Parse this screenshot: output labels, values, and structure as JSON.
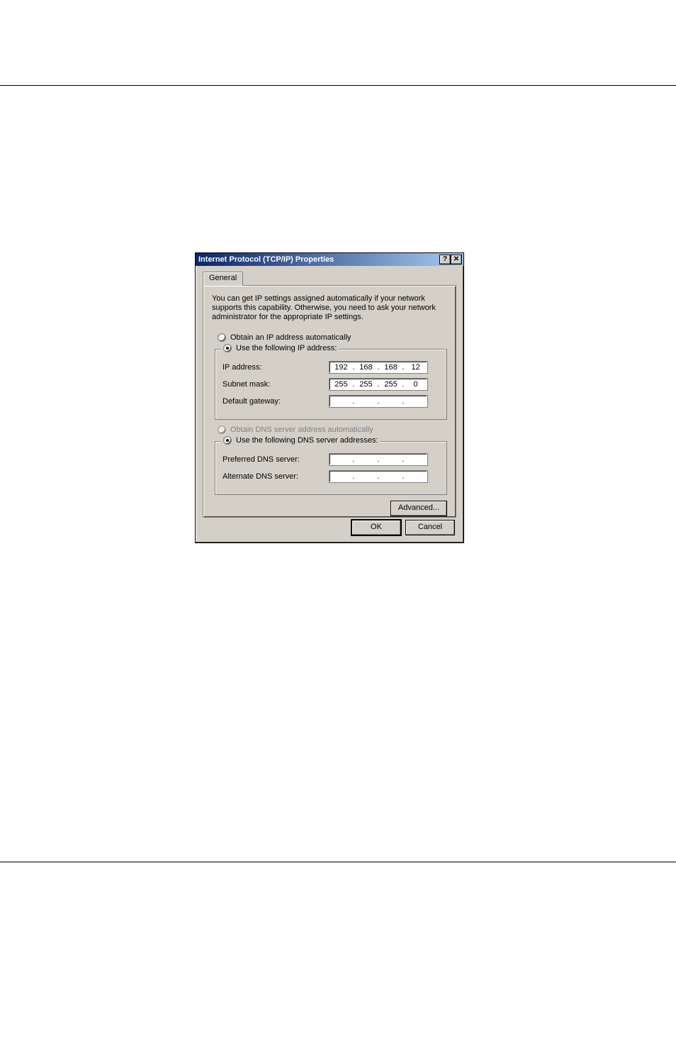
{
  "dialog": {
    "title": "Internet Protocol (TCP/IP) Properties",
    "tabs": {
      "general": "General"
    },
    "info": "You can get IP settings assigned automatically if your network supports this capability. Otherwise, you need to ask your network administrator for the appropriate IP settings.",
    "radios": {
      "obtain_ip": "Obtain an IP address automatically",
      "use_ip": "Use the following IP address:",
      "obtain_dns": "Obtain DNS server address automatically",
      "use_dns": "Use the following DNS server addresses:"
    },
    "labels": {
      "ip_address": "IP address:",
      "subnet_mask": "Subnet mask:",
      "default_gateway": "Default gateway:",
      "preferred_dns": "Preferred DNS server:",
      "alternate_dns": "Alternate DNS server:"
    },
    "values": {
      "ip_address": {
        "o1": "192",
        "o2": "168",
        "o3": "168",
        "o4": "12"
      },
      "subnet_mask": {
        "o1": "255",
        "o2": "255",
        "o3": "255",
        "o4": "0"
      },
      "default_gateway": {
        "o1": "",
        "o2": "",
        "o3": "",
        "o4": ""
      },
      "preferred_dns": {
        "o1": "",
        "o2": "",
        "o3": "",
        "o4": ""
      },
      "alternate_dns": {
        "o1": "",
        "o2": "",
        "o3": "",
        "o4": ""
      }
    },
    "buttons": {
      "advanced": "Advanced...",
      "ok": "OK",
      "cancel": "Cancel"
    },
    "winicons": {
      "help": "?",
      "close": "✕"
    }
  }
}
